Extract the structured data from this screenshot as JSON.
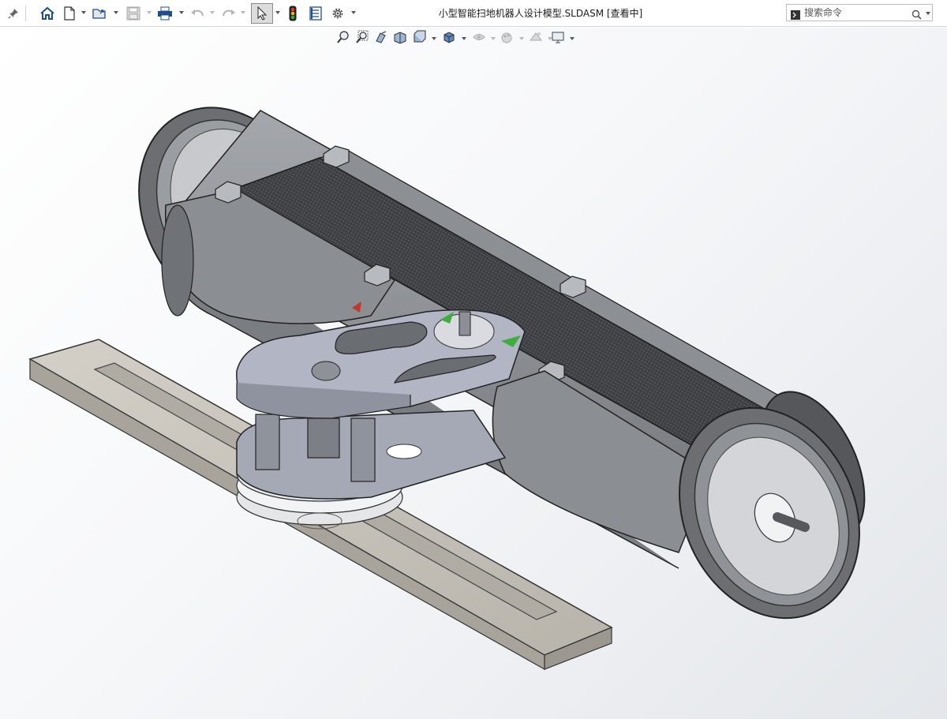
{
  "window": {
    "title": "小型智能扫地机器人设计模型.SLDASM [查看中]"
  },
  "toolbar": {
    "items": [
      {
        "name": "pin-icon"
      },
      {
        "name": "home-icon"
      },
      {
        "name": "new-document-icon"
      },
      {
        "name": "open-folder-icon"
      },
      {
        "name": "save-icon"
      },
      {
        "name": "print-icon"
      },
      {
        "name": "undo-icon"
      },
      {
        "name": "redo-icon"
      },
      {
        "name": "select-arrow-icon"
      },
      {
        "name": "traffic-light-icon"
      },
      {
        "name": "file-properties-icon"
      },
      {
        "name": "gear-icon"
      }
    ]
  },
  "search": {
    "placeholder": "搜索命令"
  },
  "view_toolbar": {
    "items": [
      {
        "name": "zoom-to-fit-icon"
      },
      {
        "name": "zoom-to-area-icon"
      },
      {
        "name": "previous-view-icon"
      },
      {
        "name": "section-view-icon"
      },
      {
        "name": "view-orientation-icon"
      },
      {
        "name": "display-style-icon"
      },
      {
        "name": "hide-show-items-icon"
      },
      {
        "name": "edit-appearance-icon"
      },
      {
        "name": "apply-scene-icon"
      },
      {
        "name": "view-settings-icon"
      }
    ]
  },
  "colors": {
    "accent_border": "#8a8a8a",
    "viewport_top": "#ffffff",
    "viewport_bottom": "#e3e6ea",
    "part_metal": "#8d9095",
    "part_plate": "#a9adbb",
    "carbon": "#3e3f42",
    "rail": "#c9c5bd",
    "green_marker": "#3fae3f",
    "red_marker": "#c0392b"
  }
}
